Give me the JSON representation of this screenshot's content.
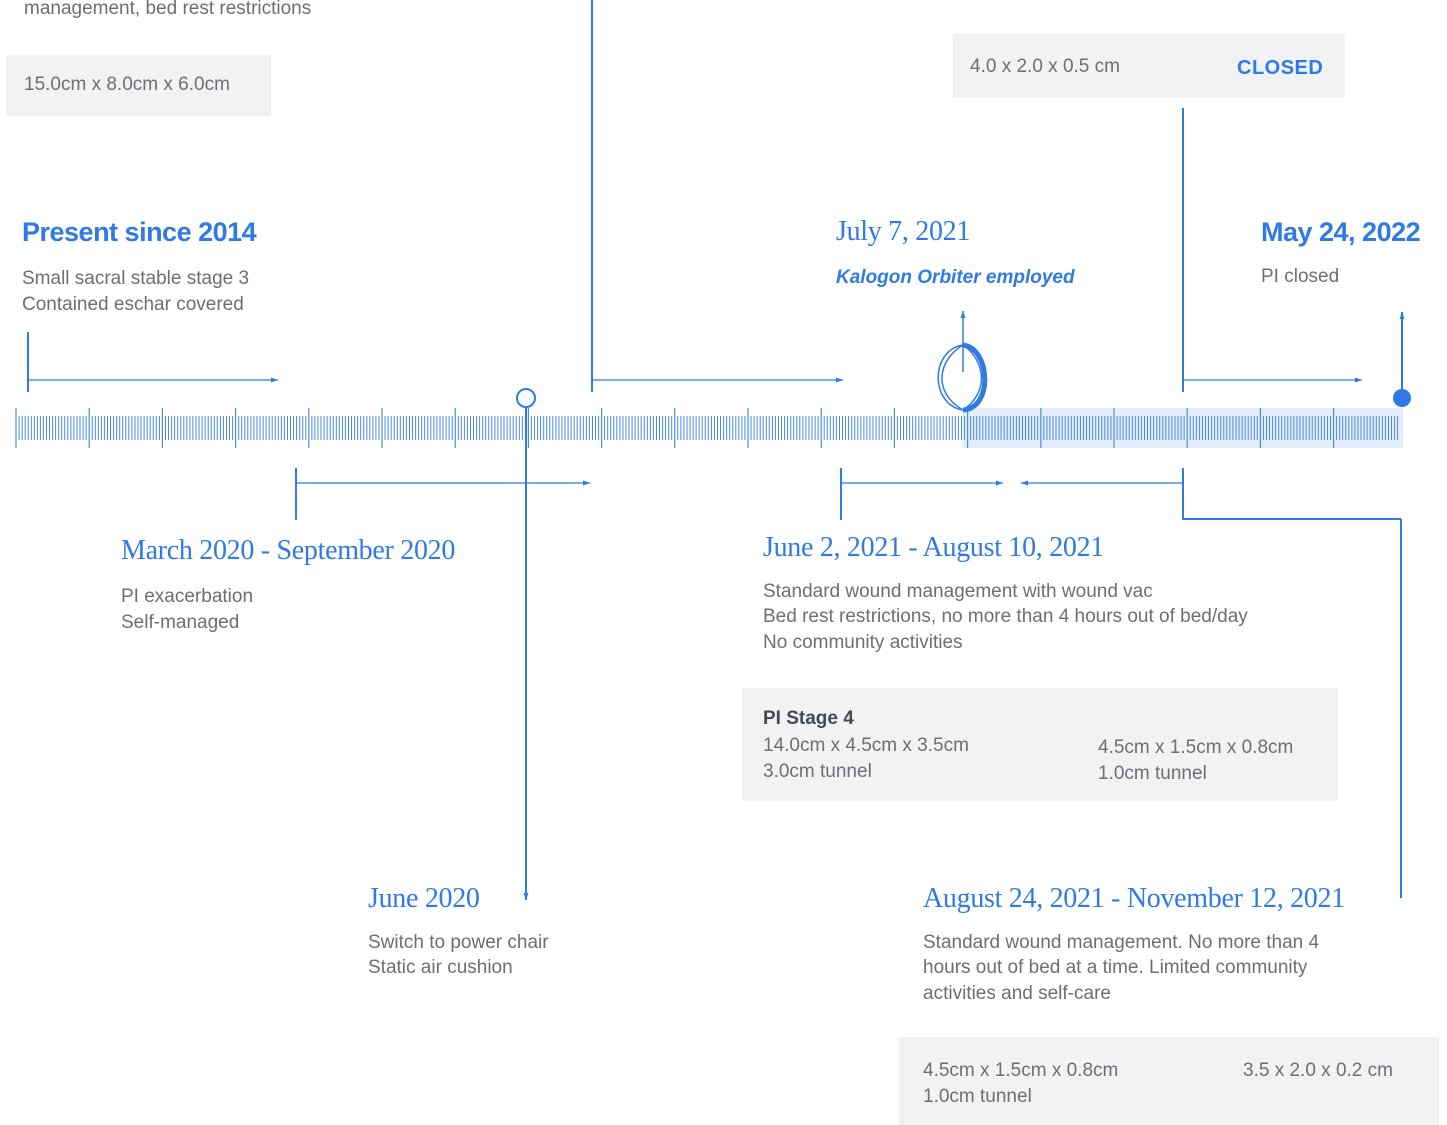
{
  "top_left": {
    "partial_text": "management, bed rest restrictions",
    "box_text": "15.0cm x 8.0cm x 6.0cm"
  },
  "top_right": {
    "from": "4.0 x 2.0 x 0.5 cm",
    "status": "CLOSED"
  },
  "events": {
    "present": {
      "title": "Present since 2014",
      "line1": "Small sacral stable stage 3",
      "line2": "Contained eschar covered"
    },
    "july": {
      "title": "July 7, 2021",
      "subtitle": "Kalogon Orbiter employed"
    },
    "may": {
      "title": "May 24, 2022",
      "line1": "PI closed"
    },
    "march": {
      "title": "March 2020 - September 2020",
      "line1": "PI exacerbation",
      "line2": "Self-managed"
    },
    "june2021": {
      "title": "June 2, 2021 - August 10, 2021",
      "line1": "Standard wound management with wound vac",
      "line2": "Bed rest restrictions, no more than 4 hours out of bed/day",
      "line3": "No community activities"
    },
    "june2020": {
      "title": "June 2020",
      "line1": "Switch to power chair",
      "line2": "Static air cushion"
    },
    "august": {
      "title": "August 24, 2021 - November 12, 2021",
      "line1": "Standard wound management. No more than 4",
      "line2": "hours out of bed at a time. Limited community",
      "line3": "activities and self-care"
    }
  },
  "stage4_box": {
    "label": "PI Stage 4",
    "from_line1": "14.0cm x 4.5cm x 3.5cm",
    "from_line2": "3.0cm tunnel",
    "to_line1": "4.5cm x 1.5cm x 0.8cm",
    "to_line2": "1.0cm tunnel"
  },
  "aug_box": {
    "from_line1": "4.5cm x 1.5cm x 0.8cm",
    "from_line2": "1.0cm tunnel",
    "to_line1": "3.5 x 2.0 x 0.2 cm"
  },
  "colors": {
    "accent": "#2f7ae5",
    "text": "#6b6f73",
    "box": "#f1f2f4",
    "band": "#e3edfb"
  },
  "icons": [
    "orbiter-logo-icon",
    "arrow-right-icon",
    "timeline-marker-icon"
  ]
}
